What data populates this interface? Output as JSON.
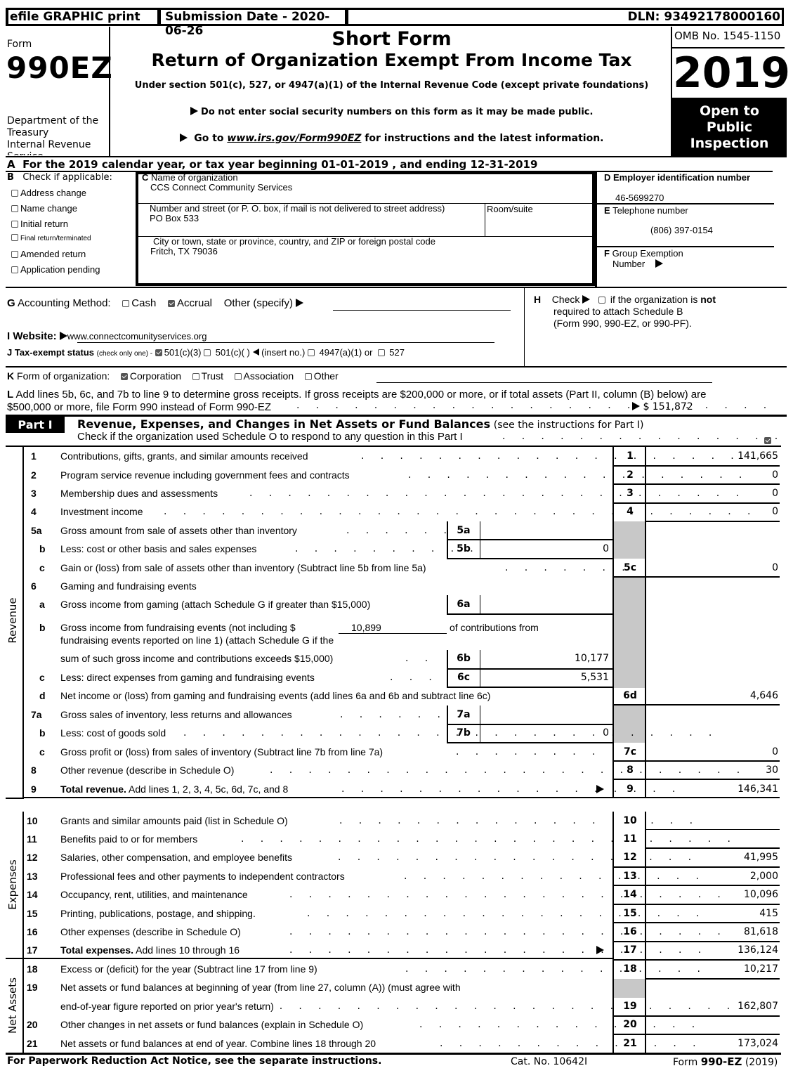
{
  "header": {
    "efile_label": "efile GRAPHIC print",
    "submission_date": "Submission Date - 2020-06-26",
    "dln": "DLN: 93492178000160",
    "form_label": "Form",
    "form_number": "990EZ",
    "department": [
      "Department of the",
      "Treasury",
      "Internal Revenue",
      "Service"
    ],
    "title_line1": "Short Form",
    "title_line2": "Return of Organization Exempt From Income Tax",
    "subtitle": "Under section 501(c), 527, or 4947(a)(1) of the Internal Revenue Code (except private foundations)",
    "notice_ssn": "Do not enter social security numbers on this form as it may be made public.",
    "goto_prefix": "Go to ",
    "goto_link": "www.irs.gov/Form990EZ",
    "goto_suffix": " for instructions and the latest information.",
    "omb": "OMB No. 1545-1150",
    "year": "2019",
    "open_public": [
      "Open to",
      "Public",
      "Inspection"
    ]
  },
  "line_a": "For the 2019 calendar year, or tax year beginning 01-01-2019 , and ending 12-31-2019",
  "line_a_letter": "A",
  "section_b": {
    "letter": "B",
    "label": "Check if applicable:",
    "options": [
      {
        "label": "Address change",
        "checked": false
      },
      {
        "label": "Name change",
        "checked": false
      },
      {
        "label": "Initial return",
        "checked": false
      },
      {
        "label": "Final return/terminated",
        "checked": false
      },
      {
        "label": "Amended return",
        "checked": false
      },
      {
        "label": "Application pending",
        "checked": false
      }
    ]
  },
  "section_c": {
    "letter": "C",
    "name_label": "Name of organization",
    "name_value": "CCS Connect Community Services",
    "street_label": "Number and street (or P. O. box, if mail is not delivered to street address)",
    "street_value": "PO Box 533",
    "room_label": "Room/suite",
    "room_value": "",
    "city_label": "City or town, state or province, country, and ZIP or foreign postal code",
    "city_value": "Fritch, TX   79036"
  },
  "section_d": {
    "letter": "D",
    "label": "Employer identification number",
    "value": "46-5699270"
  },
  "section_e": {
    "letter": "E",
    "label": "Telephone number",
    "value": "(806) 397-0154"
  },
  "section_f": {
    "letter": "F",
    "label_line1": "Group Exemption",
    "label_line2": "Number",
    "value": ""
  },
  "section_g": {
    "letter": "G",
    "label": "Accounting Method:",
    "options": [
      {
        "label": "Cash",
        "checked": false
      },
      {
        "label": "Accrual",
        "checked": true
      }
    ],
    "other_label": "Other (specify)",
    "other_value": ""
  },
  "section_h": {
    "letter": "H",
    "prefix": "Check",
    "text1": "if the organization is",
    "text_bold": "not",
    "text2": "required to attach Schedule B",
    "text3": "(Form 990, 990-EZ, or 990-PF).",
    "checked": false
  },
  "section_i": {
    "label": "I Website:",
    "value": "www.connectcomunityservices.org"
  },
  "section_j": {
    "label": "J Tax-exempt status",
    "note": "(check only one) -",
    "options": [
      {
        "label": "501(c)(3)",
        "checked": true
      },
      {
        "label": "501(c)(   )",
        "checked": false
      },
      {
        "label": "4947(a)(1) or",
        "checked": false
      },
      {
        "label": "527",
        "checked": false
      }
    ],
    "insert_no": "(insert no.)"
  },
  "section_k": {
    "letter": "K",
    "label": "Form of organization:",
    "options": [
      {
        "label": "Corporation",
        "checked": true
      },
      {
        "label": "Trust",
        "checked": false
      },
      {
        "label": "Association",
        "checked": false
      },
      {
        "label": "Other",
        "checked": false
      }
    ]
  },
  "section_l": {
    "letter": "L",
    "text1": "Add lines 5b, 6c, and 7b to line 9 to determine gross receipts. If gross receipts are $200,000 or more, or if total assets (Part II, column (B) below) are",
    "text2": "$500,000 or more, file Form 990 instead of Form 990-EZ",
    "value": "$ 151,872"
  },
  "part1": {
    "badge": "Part I",
    "title": "Revenue, Expenses, and Changes in Net Assets or Fund Balances",
    "title_note": "(see the instructions for Part I)",
    "check_text": "Check if the organization used Schedule O to respond to any question in this Part I",
    "schedule_o_checked": true,
    "side_labels": {
      "revenue": "Revenue",
      "expenses": "Expenses",
      "net_assets": "Net Assets"
    }
  },
  "lines": {
    "l1": {
      "num": "1",
      "text": "Contributions, gifts, grants, and similar amounts received",
      "box": "1",
      "value": "141,665"
    },
    "l2": {
      "num": "2",
      "text": "Program service revenue including government fees and contracts",
      "box": "2",
      "value": "0"
    },
    "l3": {
      "num": "3",
      "text": "Membership dues and assessments",
      "box": "3",
      "value": "0"
    },
    "l4": {
      "num": "4",
      "text": "Investment income",
      "box": "4",
      "value": "0"
    },
    "l5a": {
      "num": "5a",
      "text": "Gross amount from sale of assets other than inventory",
      "box": "5a",
      "value": ""
    },
    "l5b": {
      "num": "b",
      "text": "Less: cost or other basis and sales expenses",
      "box": "5b",
      "value": "0"
    },
    "l5c": {
      "num": "c",
      "text": "Gain or (loss) from sale of assets other than inventory (Subtract line 5b from line 5a)",
      "box": "5c",
      "value": "0"
    },
    "l6": {
      "num": "6",
      "text": "Gaming and fundraising events"
    },
    "l6a": {
      "num": "a",
      "text": "Gross income from gaming (attach Schedule G if greater than $15,000)",
      "box": "6a",
      "value": ""
    },
    "l6b": {
      "num": "b",
      "text1": "Gross income from fundraising events (not including $",
      "contrib_value": "10,899",
      "text1b": "of contributions from",
      "text2": "fundraising events reported on line 1) (attach Schedule G if the",
      "text3": "sum of such gross income and contributions exceeds $15,000)",
      "box": "6b",
      "value": "10,177"
    },
    "l6c": {
      "num": "c",
      "text": "Less: direct expenses from gaming and fundraising events",
      "box": "6c",
      "value": "5,531"
    },
    "l6d": {
      "num": "d",
      "text": "Net income or (loss) from gaming and fundraising events (add lines 6a and 6b and subtract line 6c)",
      "box": "6d",
      "value": "4,646"
    },
    "l7a": {
      "num": "7a",
      "text": "Gross sales of inventory, less returns and allowances",
      "box": "7a",
      "value": ""
    },
    "l7b": {
      "num": "b",
      "text": "Less: cost of goods sold",
      "box": "7b",
      "value": "0"
    },
    "l7c": {
      "num": "c",
      "text": "Gross profit or (loss) from sales of inventory (Subtract line 7b from line 7a)",
      "box": "7c",
      "value": "0"
    },
    "l8": {
      "num": "8",
      "text": "Other revenue (describe in Schedule O)",
      "box": "8",
      "value": "30"
    },
    "l9": {
      "num": "9",
      "text_bold": "Total revenue.",
      "text": " Add lines 1, 2, 3, 4, 5c, 6d, 7c, and 8",
      "box": "9",
      "value": "146,341"
    },
    "l10": {
      "num": "10",
      "text": "Grants and similar amounts paid (list in Schedule O)",
      "box": "10",
      "value": ""
    },
    "l11": {
      "num": "11",
      "text": "Benefits paid to or for members",
      "box": "11",
      "value": ""
    },
    "l12": {
      "num": "12",
      "text": "Salaries, other compensation, and employee benefits",
      "box": "12",
      "value": "41,995"
    },
    "l13": {
      "num": "13",
      "text": "Professional fees and other payments to independent contractors",
      "box": "13",
      "value": "2,000"
    },
    "l14": {
      "num": "14",
      "text": "Occupancy, rent, utilities, and maintenance",
      "box": "14",
      "value": "10,096"
    },
    "l15": {
      "num": "15",
      "text": "Printing, publications, postage, and shipping.",
      "box": "15",
      "value": "415"
    },
    "l16": {
      "num": "16",
      "text": "Other expenses (describe in Schedule O)",
      "box": "16",
      "value": "81,618"
    },
    "l17": {
      "num": "17",
      "text_bold": "Total expenses.",
      "text": " Add lines 10 through 16",
      "box": "17",
      "value": "136,124"
    },
    "l18": {
      "num": "18",
      "text": "Excess or (deficit) for the year (Subtract line 17 from line 9)",
      "box": "18",
      "value": "10,217"
    },
    "l19": {
      "num": "19",
      "text1": "Net assets or fund balances at beginning of year (from line 27, column (A)) (must agree with",
      "text2": "end-of-year figure reported on prior year's return)",
      "box": "19",
      "value": "162,807"
    },
    "l20": {
      "num": "20",
      "text": "Other changes in net assets or fund balances (explain in Schedule O)",
      "box": "20",
      "value": ""
    },
    "l21": {
      "num": "21",
      "text": "Net assets or fund balances at end of year. Combine lines 18 through 20",
      "box": "21",
      "value": "173,024"
    }
  },
  "footer": {
    "paperwork": "For Paperwork Reduction Act Notice, see the separate instructions.",
    "cat_no": "Cat. No. 10642I",
    "form_prefix": "Form ",
    "form_bold": "990-EZ",
    "form_suffix": " (2019)"
  }
}
